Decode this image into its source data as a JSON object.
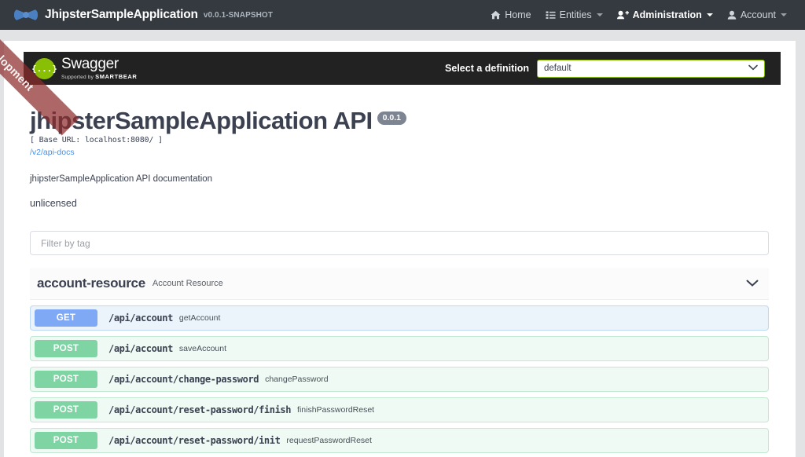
{
  "navbar": {
    "brand_name": "JhipsterSampleApplication",
    "brand_version": "v0.0.1-SNAPSHOT",
    "brand_logo_icon": "bowtie-logo-icon",
    "items": [
      {
        "label": "Home",
        "icon": "home-icon",
        "caret": false
      },
      {
        "label": "Entities",
        "icon": "list-icon",
        "caret": true
      },
      {
        "label": "Administration",
        "icon": "user-plus-icon",
        "caret": true
      },
      {
        "label": "Account",
        "icon": "user-icon",
        "caret": true
      }
    ]
  },
  "ribbon": {
    "label": "Development"
  },
  "swagger_header": {
    "logo_glyph": "{...}",
    "logo_name": "Swagger",
    "logo_sub_prefix": "Supported by",
    "logo_sub_brand": "SMARTBEAR",
    "select_label": "Select a definition",
    "select_value": "default",
    "select_options": [
      "default"
    ],
    "chevron_icon": "chevron-down-icon"
  },
  "info": {
    "title": "jhipsterSampleApplication API",
    "version_badge": "0.0.1",
    "base_url": "[ Base URL: localhost:8080/ ]",
    "api_docs_link": "/v2/api-docs",
    "description": "jhipsterSampleApplication API documentation",
    "license": "unlicensed"
  },
  "filter": {
    "placeholder": "Filter by tag",
    "value": ""
  },
  "tag_section": {
    "name": "account-resource",
    "description": "Account Resource",
    "chevron_icon": "chevron-down-icon"
  },
  "operations": [
    {
      "method": "GET",
      "path": "/api/account",
      "summary": "getAccount"
    },
    {
      "method": "POST",
      "path": "/api/account",
      "summary": "saveAccount"
    },
    {
      "method": "POST",
      "path": "/api/account/change-password",
      "summary": "changePassword"
    },
    {
      "method": "POST",
      "path": "/api/account/reset-password/finish",
      "summary": "finishPasswordReset"
    },
    {
      "method": "POST",
      "path": "/api/account/reset-password/init",
      "summary": "requestPasswordReset"
    }
  ],
  "colors": {
    "navbar_bg": "#343a40",
    "swagger_bg": "#222222",
    "swagger_green": "#89bf04",
    "get_badge": "#7fa8f5",
    "post_badge": "#7fd4a4",
    "link_blue": "#4990e2",
    "version_badge_bg": "#7d8492",
    "ribbon_red": "#8e2c2c"
  }
}
